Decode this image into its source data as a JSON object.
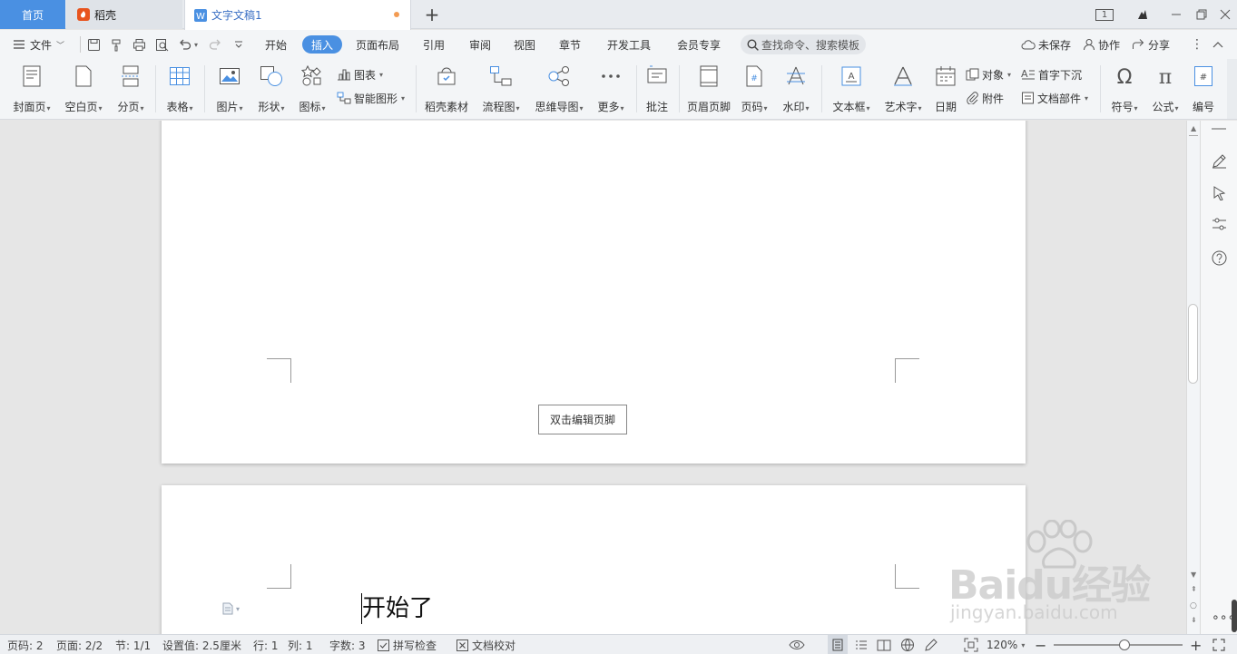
{
  "tabs": {
    "home": "首页",
    "daoke": "稻壳",
    "document": "文字文稿1"
  },
  "window": {
    "page_count_badge": "1"
  },
  "menu": {
    "file": "文件",
    "items": [
      "开始",
      "插入",
      "页面布局",
      "引用",
      "审阅",
      "视图",
      "章节",
      "开发工具",
      "会员专享"
    ],
    "active": "插入",
    "search_placeholder": "查找命令、搜索模板",
    "unsaved": "未保存",
    "collaborate": "协作",
    "share": "分享"
  },
  "ribbon": {
    "cover_page": "封面页",
    "blank_page": "空白页",
    "page_break": "分页",
    "table": "表格",
    "picture": "图片",
    "shape": "形状",
    "icon": "图标",
    "chart": "图表",
    "smart_art": "智能图形",
    "daoke_assets": "稻壳素材",
    "flowchart": "流程图",
    "mindmap": "思维导图",
    "more": "更多",
    "comment": "批注",
    "header_footer": "页眉页脚",
    "page_number": "页码",
    "watermark": "水印",
    "text_box": "文本框",
    "word_art": "艺术字",
    "date": "日期",
    "object": "对象",
    "attachment": "附件",
    "drop_cap": "首字下沉",
    "doc_parts": "文档部件",
    "symbol": "符号",
    "formula": "公式",
    "numbering": "编号"
  },
  "document": {
    "footer_hint": "双击编辑页脚",
    "body_text": "开始了"
  },
  "status": {
    "page_number": "页码: 2",
    "pages": "页面: 2/2",
    "section": "节: 1/1",
    "position": "设置值: 2.5厘米",
    "line": "行: 1",
    "column": "列: 1",
    "word_count": "字数: 3",
    "spell_check": "拼写检查",
    "doc_proof": "文档校对",
    "zoom": "120%",
    "zoom_level": 0.55
  },
  "watermark": {
    "brand": "Baidu经验",
    "url": "jingyan.baidu.com"
  },
  "colors": {
    "accent": "#4a90e2",
    "doc_tab_text": "#3a6fc4",
    "unsaved_dot": "#f39b52",
    "daoke_icon": "#e8541e"
  }
}
